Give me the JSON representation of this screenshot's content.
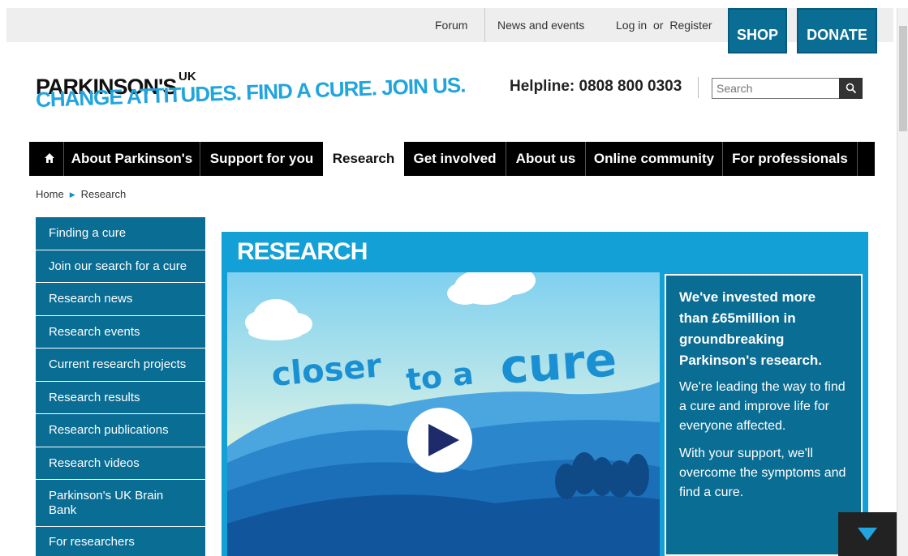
{
  "topbar": {
    "forum": "Forum",
    "news_events": "News and events",
    "login": "Log in",
    "or": "or",
    "register": "Register",
    "shop": "SHOP",
    "donate": "DONATE"
  },
  "logo": {
    "name": "PARKINSON'S",
    "uk": "UK",
    "tagline": "CHANGE ATTITUDES. FIND A CURE. JOIN US."
  },
  "helpline": "Helpline: 0808 800 0303",
  "search": {
    "placeholder": "Search",
    "icon": "search-icon"
  },
  "nav": {
    "home_icon": "home-icon",
    "items": [
      {
        "label": "About Parkinson's"
      },
      {
        "label": "Support for you"
      },
      {
        "label": "Research"
      },
      {
        "label": "Get involved"
      },
      {
        "label": "About us"
      },
      {
        "label": "Online community"
      },
      {
        "label": "For professionals"
      }
    ],
    "active": "Research"
  },
  "breadcrumb": {
    "home": "Home",
    "current": "Research"
  },
  "sidebar": {
    "items": [
      {
        "label": "Finding a cure"
      },
      {
        "label": "Join our search for a cure"
      },
      {
        "label": "Research news"
      },
      {
        "label": "Research events"
      },
      {
        "label": "Current research projects"
      },
      {
        "label": "Research results"
      },
      {
        "label": "Research publications"
      },
      {
        "label": "Research videos"
      },
      {
        "label": "Parkinson's UK Brain Bank"
      },
      {
        "label": "For researchers"
      }
    ]
  },
  "hero": {
    "title": "RESEARCH",
    "video_text_1": "closer",
    "video_text_2": "to a",
    "video_text_3": "cure",
    "info_heading": "We've invested more than £65million in groundbreaking Parkinson's research.",
    "info_p1": "We're leading the way to find a cure and improve life for everyone affected.",
    "info_p2": "With your support, we'll overcome the symptoms and find a cure."
  },
  "colors": {
    "brand_blue": "#0a6d94",
    "accent_cyan": "#13a0d6",
    "tagline_blue": "#22a5dd"
  }
}
